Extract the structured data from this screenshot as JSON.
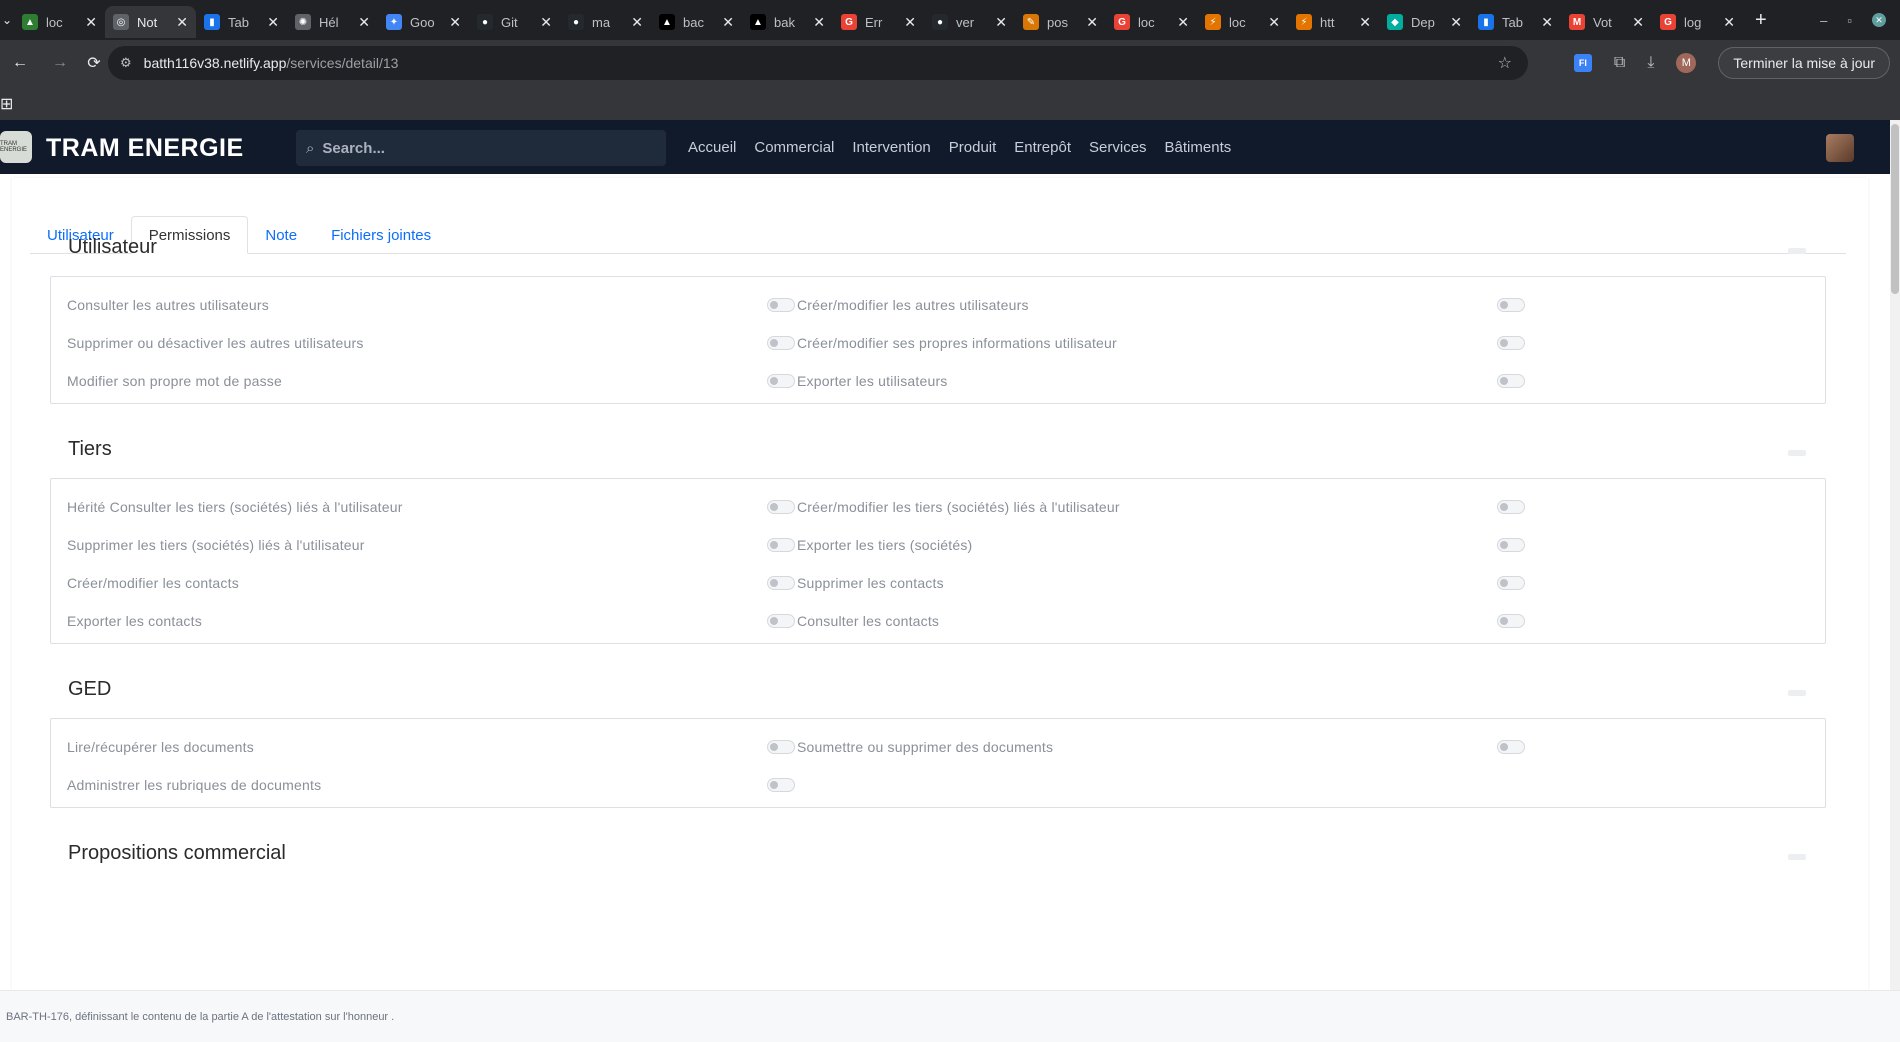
{
  "browser": {
    "tabs": [
      {
        "title": "loc",
        "color": "#2e7d32",
        "glyph": "▲",
        "active": false
      },
      {
        "title": "Not",
        "color": "#5f6368",
        "glyph": "◎",
        "active": true
      },
      {
        "title": "Tab",
        "color": "#1a73e8",
        "glyph": "▮",
        "active": false
      },
      {
        "title": "Hél",
        "color": "#5f6368",
        "glyph": "✺",
        "active": false
      },
      {
        "title": "Goo",
        "color": "#4285f4",
        "glyph": "✦",
        "active": false
      },
      {
        "title": "Git",
        "color": "#24292e",
        "glyph": "●",
        "active": false
      },
      {
        "title": "ma",
        "color": "#24292e",
        "glyph": "●",
        "active": false
      },
      {
        "title": "bac",
        "color": "#000000",
        "glyph": "▲",
        "active": false
      },
      {
        "title": "bak",
        "color": "#000000",
        "glyph": "▲",
        "active": false
      },
      {
        "title": "Err",
        "color": "#ea4335",
        "glyph": "G",
        "active": false
      },
      {
        "title": "ver",
        "color": "#24292e",
        "glyph": "●",
        "active": false
      },
      {
        "title": "pos",
        "color": "#d97706",
        "glyph": "✎",
        "active": false
      },
      {
        "title": "loc",
        "color": "#ea4335",
        "glyph": "G",
        "active": false
      },
      {
        "title": "loc",
        "color": "#e37400",
        "glyph": "⚡",
        "active": false
      },
      {
        "title": "htt",
        "color": "#e37400",
        "glyph": "⚡",
        "active": false
      },
      {
        "title": "Dep",
        "color": "#00ad9f",
        "glyph": "◆",
        "active": false
      },
      {
        "title": "Tab",
        "color": "#1a73e8",
        "glyph": "▮",
        "active": false
      },
      {
        "title": "Vot",
        "color": "#ea4335",
        "glyph": "M",
        "active": false
      },
      {
        "title": "log",
        "color": "#ea4335",
        "glyph": "G",
        "active": false
      }
    ],
    "url_domain": "batth116v38.netlify.app",
    "url_path": "/services/detail/13",
    "profile_initial": "M",
    "ext_label": "FI",
    "update_label": "Terminer la mise à jour"
  },
  "app": {
    "brand": "TRAM ENERGIE",
    "logo_text": "TRAM ENERGIE",
    "search_placeholder": "Search...",
    "nav": [
      "Accueil",
      "Commercial",
      "Intervention",
      "Produit",
      "Entrepôt",
      "Services",
      "Bâtiments"
    ]
  },
  "tabs": [
    {
      "label": "Utilisateur",
      "active": false
    },
    {
      "label": "Permissions",
      "active": true
    },
    {
      "label": "Note",
      "active": false
    },
    {
      "label": "Fichiers jointes",
      "active": false
    }
  ],
  "sections": [
    {
      "title": "Utilisateur",
      "rows": [
        [
          "Consulter les autres utilisateurs",
          "Créer/modifier les autres utilisateurs"
        ],
        [
          "Supprimer ou désactiver les autres utilisateurs",
          "Créer/modifier ses propres informations utilisateur"
        ],
        [
          "Modifier son propre mot de passe",
          "Exporter les utilisateurs"
        ]
      ]
    },
    {
      "title": "Tiers",
      "rows": [
        [
          "Hérité Consulter les tiers (sociétés) liés à l'utilisateur",
          "Créer/modifier les tiers (sociétés) liés à l'utilisateur"
        ],
        [
          "Supprimer les tiers (sociétés) liés à l'utilisateur",
          "Exporter les tiers (sociétés)"
        ],
        [
          "Créer/modifier les contacts",
          "Supprimer les contacts"
        ],
        [
          "Exporter les contacts",
          "Consulter les contacts"
        ]
      ]
    },
    {
      "title": "GED",
      "rows": [
        [
          "Lire/récupérer les documents",
          "Soumettre ou supprimer des documents"
        ],
        [
          "Administrer les rubriques de documents",
          ""
        ]
      ]
    },
    {
      "title": "Propositions commercial",
      "rows": []
    }
  ],
  "footer_text": "BAR-TH-176, définissant le contenu de la partie A de l'attestation sur l'honneur ."
}
